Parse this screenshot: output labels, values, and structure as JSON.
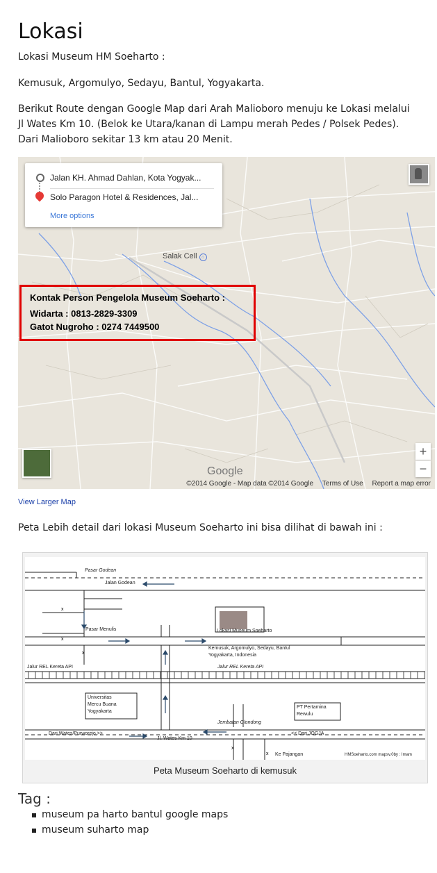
{
  "heading": "Lokasi",
  "intro": "Lokasi Museum HM Soeharto :",
  "address": "Kemusuk, Argomulyo, Sedayu, Bantul, Yogyakarta.",
  "route_lines": [
    "Berikut Route dengan Google Map dari Arah Malioboro menuju ke Lokasi melalui",
    "Jl Wates Km 10. (Belok ke Utara/kanan di Lampu merah Pedes / Polsek Pedes).",
    "Dari Malioboro sekitar 13 km atau 20 Menit."
  ],
  "map": {
    "origin": "Jalan KH. Ahmad Dahlan, Kota Yogyak...",
    "destination": "Solo Paragon Hotel & Residences, Jal...",
    "more_options": "More options",
    "place_label": "Salak Cell",
    "contact_title": "Kontak Person Pengelola Museum Soeharto :",
    "contact_1": "Widarta : 0813-2829-3309",
    "contact_2": "Gatot Nugroho : 0274 7449500",
    "zoom_in": "+",
    "zoom_out": "−",
    "google_logo": "Google",
    "copyright": "©2014 Google - Map data ©2014 Google",
    "terms": "Terms of Use",
    "report": "Report a map error"
  },
  "view_larger_map": "View Larger Map",
  "detail_intro": "Peta Lebih detail dari lokasi Museum Soeharto ini bisa dilihat di bawah ini :",
  "detail_map": {
    "pasar_godean": "Pasar Godean",
    "jalan_godean": "Jalan Godean",
    "pasar_menulis": "Pasar Menulis",
    "museum_label": "Lokasi Museum Soeharto",
    "museum_addr_1": "Kemusuk, Argomulyo, Sedayu, Bantul",
    "museum_addr_2": "Yogyakarta, Indonesia",
    "rail_left": "Jalur REL Kereta API",
    "rail_right": "Jalur REL Kereta API",
    "univ_1": "Universitas",
    "univ_2": "Mercu Buana",
    "univ_3": "Yogyakarta",
    "pertamina_1": "PT Pertamina",
    "pertamina_2": "Rewulu",
    "jembatan": "Jembatan Glondong",
    "dari_wates": "Dari Wates/Purworejo >>",
    "jl_wates": "Jl. Wates Km 10",
    "dari_jogja": "<< Dari JOGJA",
    "ke_pajangan": "Ke Pajangan",
    "credit": "HMSoeharto.com mapsv.0by : Imam",
    "caption": "Peta Museum Soeharto di kemusuk"
  },
  "tag_title": "Tag :",
  "tags": [
    "museum pa harto bantul google maps",
    "museum suharto map"
  ]
}
